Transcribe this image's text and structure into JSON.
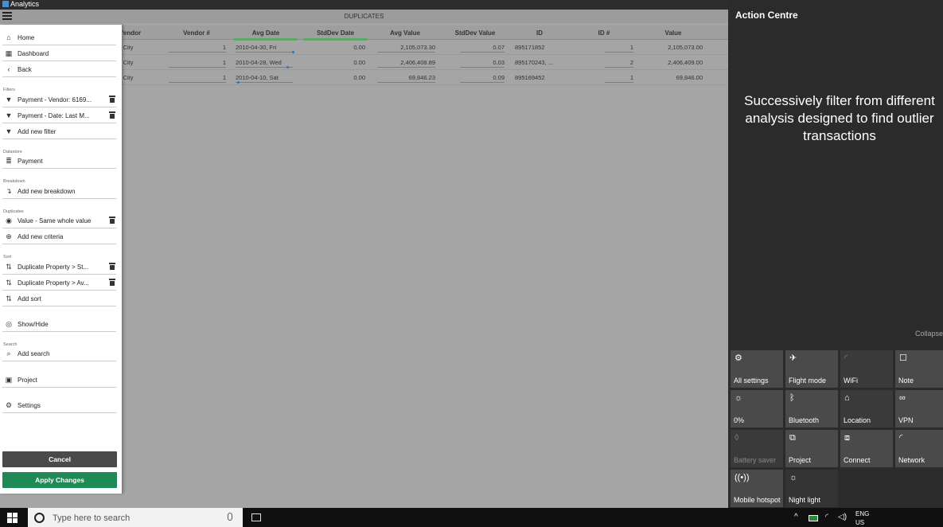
{
  "window": {
    "title": "Analytics"
  },
  "grid": {
    "title": "DUPLICATES",
    "columns": [
      "Vendor",
      "Vendor #",
      "Avg Date",
      "StdDev Date",
      "Avg Value",
      "StdDev Value",
      "ID",
      "ID #",
      "Value"
    ],
    "rows": [
      {
        "vendor": "r City",
        "vendor_no": "1",
        "avg_date": "2010-04-30, Fri",
        "stddev_date": "0.00",
        "avg_value": "2,105,073.30",
        "stddev_value": "0.07",
        "id": "895171852",
        "id_no": "1",
        "value": "2,105,073.00"
      },
      {
        "vendor": "r City",
        "vendor_no": "1",
        "avg_date": "2010-04-28, Wed",
        "stddev_date": "0.00",
        "avg_value": "2,406,408.89",
        "stddev_value": "0.03",
        "id": "895170243, ...",
        "id_no": "2",
        "value": "2,406,409.00"
      },
      {
        "vendor": "r City",
        "vendor_no": "1",
        "avg_date": "2010-04-10, Sat",
        "stddev_date": "0.00",
        "avg_value": "69,846.23",
        "stddev_value": "0.09",
        "id": "895169452",
        "id_no": "1",
        "value": "69,846.00"
      }
    ]
  },
  "menu": {
    "nav": {
      "home": "Home",
      "dashboard": "Dashboard",
      "back": "Back"
    },
    "filters": {
      "section": "Filters",
      "items": [
        "Payment - Vendor: 6169...",
        "Payment - Date: Last M..."
      ],
      "add": "Add new filter"
    },
    "datastore": {
      "section": "Datastore",
      "value": "Payment"
    },
    "breakdown": {
      "section": "Breakdown",
      "add": "Add new breakdown"
    },
    "duplicates": {
      "section": "Duplicates",
      "item": "Value - Same whole value",
      "add": "Add new criteria"
    },
    "sort": {
      "section": "Sort",
      "items": [
        "Duplicate Property > St...",
        "Duplicate Property > Av..."
      ],
      "add": "Add sort"
    },
    "showhide": "Show/Hide",
    "search": {
      "section": "Search",
      "add": "Add search"
    },
    "project": "Project",
    "settings": "Settings",
    "cancel": "Cancel",
    "apply": "Apply Changes"
  },
  "action_centre": {
    "title": "Action Centre",
    "message": "Successively filter from different analysis designed to find outlier transactions",
    "collapse": "Collapse",
    "tiles": {
      "all_settings": "All settings",
      "flight_mode": "Flight mode",
      "wifi": "WiFi",
      "note": "Note",
      "brightness": "0%",
      "bluetooth": "Bluetooth",
      "location": "Location",
      "vpn": "VPN",
      "battery_saver": "Battery saver",
      "project": "Project",
      "connect": "Connect",
      "network": "Network",
      "mobile_hotspot": "Mobile hotspot",
      "night_light": "Night light"
    }
  },
  "taskbar": {
    "search_placeholder": "Type here to search",
    "lang_line1": "ENG",
    "lang_line2": "US"
  },
  "colors": {
    "accent_green": "#1f8a55",
    "sort_indicator": "#5fa86a",
    "action_centre_bg": "#2b2b2b"
  }
}
